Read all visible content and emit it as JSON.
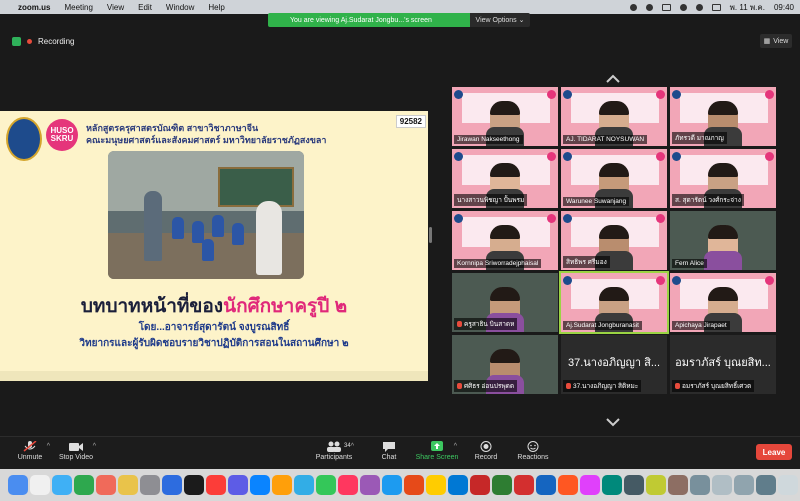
{
  "menubar": {
    "app": "zoom.us",
    "items": [
      "Meeting",
      "View",
      "Edit",
      "Window",
      "Help"
    ],
    "date": "พ. 11 พ.ค.",
    "time": "09:40"
  },
  "share_banner": {
    "message": "You are viewing Aj.Sudarat Jongbu...'s screen",
    "view_options": "View Options ⌄"
  },
  "header": {
    "recording": "Recording",
    "view_button": "View"
  },
  "slide": {
    "logo_text": "HUSO SKRU",
    "line1": "หลักสูตรครุศาสตรบัณฑิต  สาขาวิชาภาษาจีน",
    "line2": "คณะมนุษยศาสตร์และสังคมศาสตร์  มหาวิทยาลัยราชภัฏสงขลา",
    "code": "92582",
    "title_prefix": "บทบาทหน้าที่ของ",
    "title_accent": "นักศึกษาครูปี ๒",
    "by": "โดย...อาจารย์สุดารัตน์ จงบูรณสิทธิ์",
    "subtitle": "วิทยากรและผู้รับผิดชอบรายวิชาปฏิบัติการสอนในสถานศึกษา ๒"
  },
  "gallery": {
    "tiles": [
      {
        "name": "Jirawan Nakseethong",
        "muted": false,
        "kind": "slide"
      },
      {
        "name": "AJ. TIDARAT NOYSUWAN",
        "muted": false,
        "kind": "slide"
      },
      {
        "name": "ภัทรวดี มาณกาญ",
        "muted": false,
        "kind": "slide"
      },
      {
        "name": "นางสาวนพิชญา ปั้นพรม",
        "muted": false,
        "kind": "slide"
      },
      {
        "name": "Warunee Suwanjang",
        "muted": false,
        "kind": "slide"
      },
      {
        "name": "ส. สุดารัตน์ วงศ์กระจ่าง",
        "muted": false,
        "kind": "slide"
      },
      {
        "name": "Kornnipa Sriworradejphaisal",
        "muted": false,
        "kind": "slide"
      },
      {
        "name": "สิทธิพร ศรีมอง",
        "muted": false,
        "kind": "slide"
      },
      {
        "name": "Fern Alice",
        "muted": false,
        "kind": "video"
      },
      {
        "name": "ครูสาธิน บินสาดห",
        "muted": true,
        "kind": "video"
      },
      {
        "name": "Aj.Sudarat Jongburanasit",
        "muted": false,
        "kind": "slide",
        "active": true
      },
      {
        "name": "Apichaya Jirapaet",
        "muted": false,
        "kind": "slide"
      },
      {
        "name": "ศศิธร อ่อนปรพุดด",
        "muted": true,
        "kind": "video"
      },
      {
        "name": "37.นางอภิญญา สิติหมะ",
        "muted": true,
        "kind": "name",
        "big": "37.นางอภิญญา  สิ..."
      },
      {
        "name": "อมราภัสร์ บุณยสิทธิ์เศวต",
        "muted": true,
        "kind": "name",
        "big": "อมราภัสร์ บุณยสิท..."
      }
    ]
  },
  "toolbar": {
    "unmute": "Unmute",
    "stop_video": "Stop Video",
    "participants": "Participants",
    "participants_count": "34",
    "chat": "Chat",
    "share_screen": "Share Screen",
    "record": "Record",
    "reactions": "Reactions",
    "leave": "Leave"
  },
  "colors": {
    "accent_green": "#30b24a",
    "leave_red": "#e5473b",
    "active_outline": "#9bd443",
    "slide_pink": "#e0287a"
  }
}
